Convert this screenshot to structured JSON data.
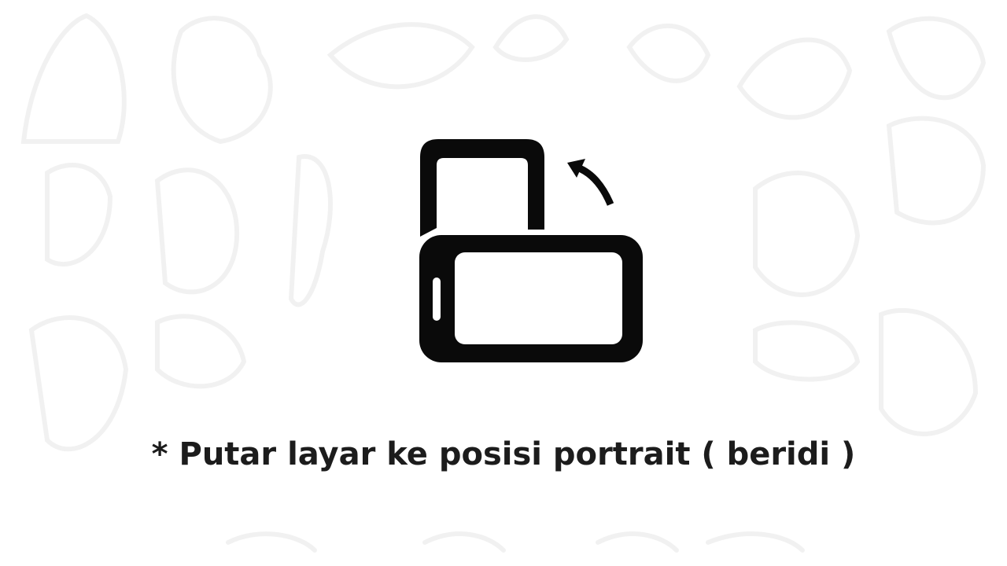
{
  "overlay": {
    "message": "* Putar layar ke posisi portrait ( beridi )",
    "icon": "rotate-device-icon",
    "background_pattern": "faint-doodle-illustrations"
  },
  "colors": {
    "background": "#ffffff",
    "foreground": "#0a0a0a",
    "text": "#1c1c1c"
  }
}
